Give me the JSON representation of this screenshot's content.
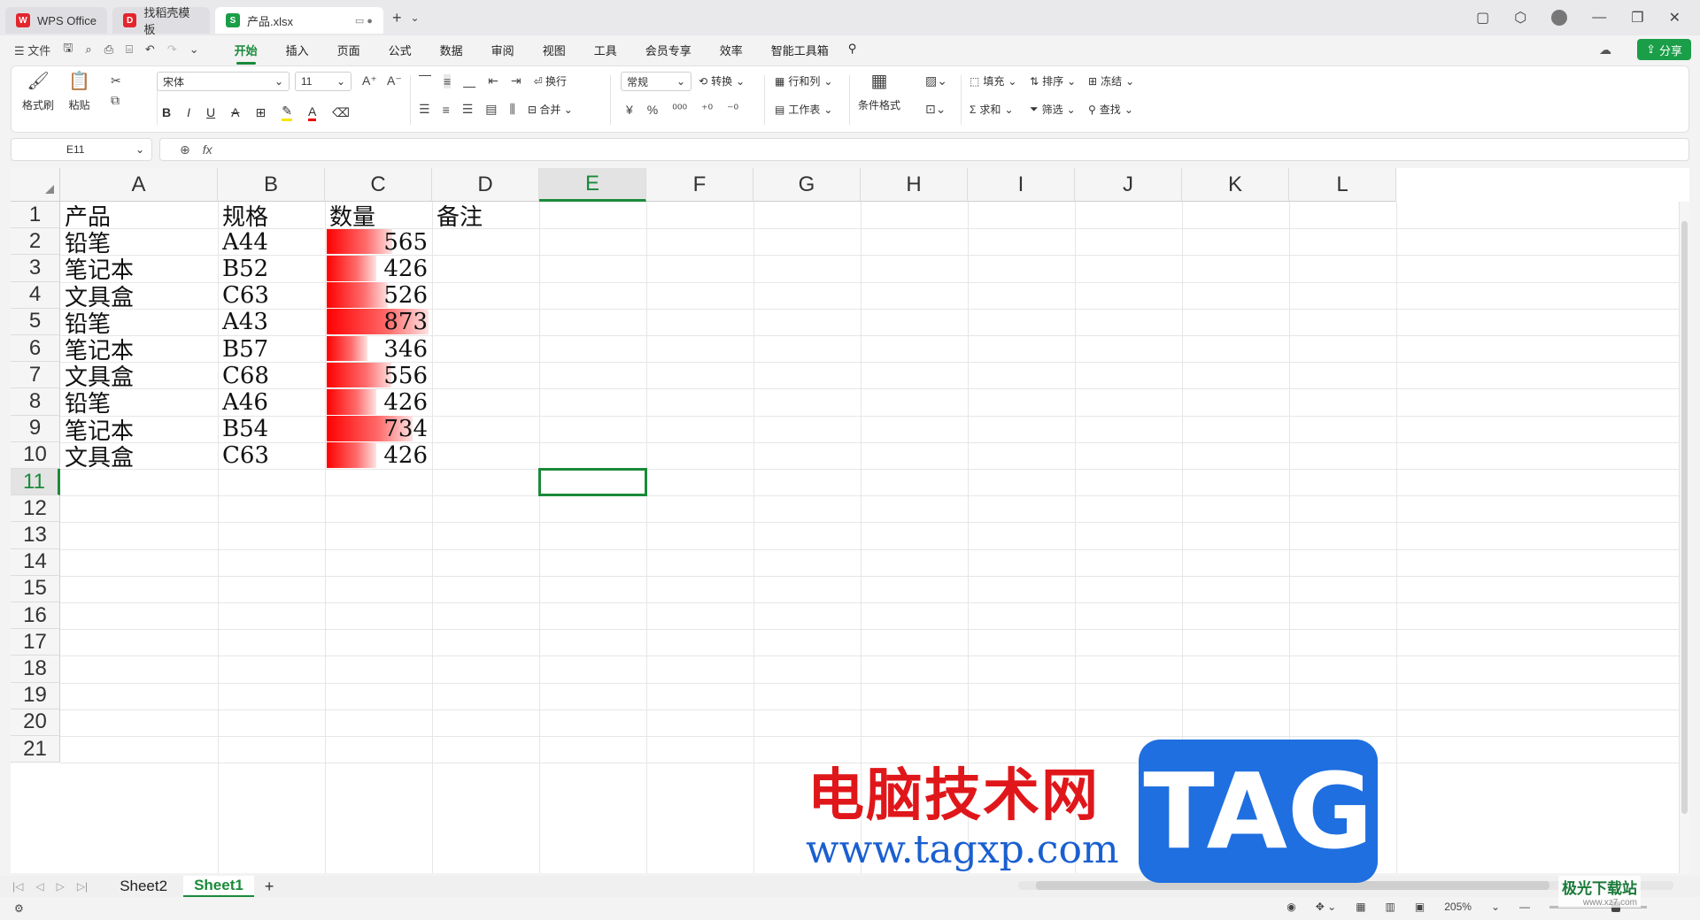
{
  "tabs": [
    {
      "label": "WPS Office",
      "logo": "W",
      "color": "#e3262e"
    },
    {
      "label": "找稻壳模板",
      "logo": "D",
      "color": "#e3262e"
    },
    {
      "label": "产品.xlsx",
      "logo": "S",
      "color": "#1a9e48"
    }
  ],
  "menu": {
    "file": "文件",
    "items": [
      "开始",
      "插入",
      "页面",
      "公式",
      "数据",
      "审阅",
      "视图",
      "工具",
      "会员专享",
      "效率",
      "智能工具箱"
    ],
    "active": "开始",
    "share": "分享"
  },
  "ribbon": {
    "format_painter": "格式刷",
    "paste": "粘贴",
    "font_name": "宋体",
    "font_size": "11",
    "wrap": "换行",
    "merge": "合并",
    "number_format": "常规",
    "convert": "转换",
    "row_col": "行和列",
    "worksheet": "工作表",
    "cond_format": "条件格式",
    "fill": "填充",
    "sort": "排序",
    "freeze": "冻结",
    "sum": "求和",
    "filter": "筛选",
    "find": "查找"
  },
  "formula_bar": {
    "name_box": "E11",
    "fx": "fx",
    "value": ""
  },
  "sheet": {
    "columns": [
      "A",
      "B",
      "C",
      "D",
      "E",
      "F",
      "G",
      "H",
      "I",
      "J",
      "K",
      "L"
    ],
    "active_column": "E",
    "rows": [
      "1",
      "2",
      "3",
      "4",
      "5",
      "6",
      "7",
      "8",
      "9",
      "10",
      "11",
      "12",
      "13",
      "14",
      "15",
      "16",
      "17",
      "18",
      "19",
      "20",
      "21"
    ],
    "active_row": "11",
    "header": [
      "产品",
      "规格",
      "数量",
      "备注"
    ],
    "data": [
      {
        "product": "铅笔",
        "spec": "A44",
        "qty": 565
      },
      {
        "product": "笔记本",
        "spec": "B52",
        "qty": 426
      },
      {
        "product": "文具盒",
        "spec": "C63",
        "qty": 526
      },
      {
        "product": "铅笔",
        "spec": "A43",
        "qty": 873
      },
      {
        "product": "笔记本",
        "spec": "B57",
        "qty": 346
      },
      {
        "product": "文具盒",
        "spec": "C68",
        "qty": 556
      },
      {
        "product": "铅笔",
        "spec": "A46",
        "qty": 426
      },
      {
        "product": "笔记本",
        "spec": "B54",
        "qty": 734
      },
      {
        "product": "文具盒",
        "spec": "C63",
        "qty": 426
      }
    ],
    "databar_max": 873,
    "databar_min": 346,
    "databar_color": "#ff0000"
  },
  "sheet_tabs": [
    "Sheet2",
    "Sheet1"
  ],
  "active_sheet": "Sheet1",
  "status": {
    "zoom": "205%"
  },
  "watermark": {
    "text": "电脑技术网",
    "url": "www.tagxp.com",
    "tag": "TAG",
    "corner": "极光下载站",
    "corner_sub": "www.xz7.com"
  }
}
